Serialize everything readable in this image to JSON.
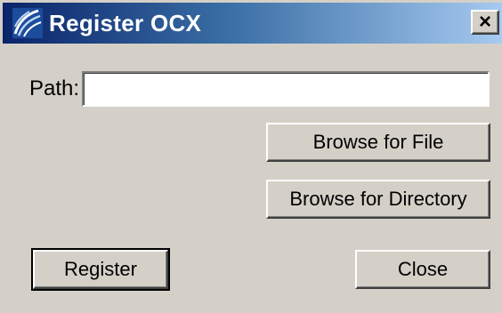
{
  "window": {
    "title": "Register OCX",
    "close_glyph": "×",
    "icon": "ocx-app-icon"
  },
  "form": {
    "path_label": "Path:",
    "path_value": "",
    "path_placeholder": ""
  },
  "buttons": {
    "browse_file": "Browse for File",
    "browse_directory": "Browse for Directory",
    "register": "Register",
    "close": "Close"
  },
  "colors": {
    "face": "#d4d0c8",
    "title_start": "#0a246a",
    "title_end": "#a6caf0",
    "title_text": "#ffffff"
  }
}
